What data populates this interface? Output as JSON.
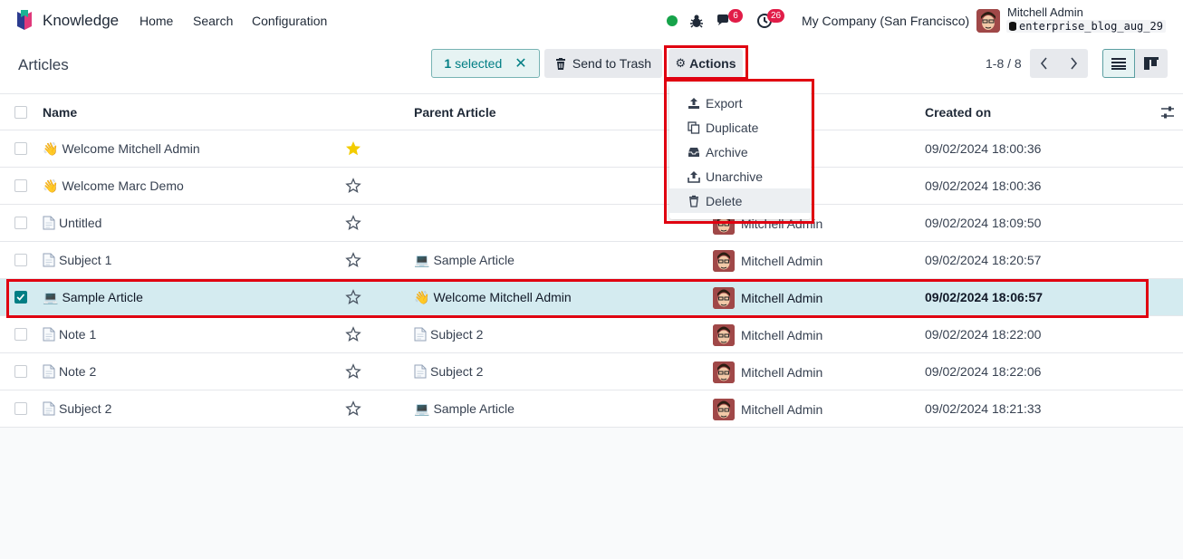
{
  "navbar": {
    "app_name": "Knowledge",
    "menu": [
      "Home",
      "Search",
      "Configuration"
    ],
    "messages_count": "6",
    "activities_count": "26",
    "company": "My Company (San Francisco)",
    "user_name": "Mitchell Admin",
    "database": "enterprise_blog_aug_29"
  },
  "control_panel": {
    "breadcrumb": "Articles",
    "selected_count": "1",
    "selected_label": "selected",
    "send_to_trash": "Send to Trash",
    "actions": "Actions",
    "pager": "1-8 / 8"
  },
  "actions_menu": [
    "Export",
    "Duplicate",
    "Archive",
    "Unarchive",
    "Delete"
  ],
  "table": {
    "columns": {
      "name": "Name",
      "parent": "Parent Article",
      "created_on": "Created on"
    },
    "rows": [
      {
        "icon": "👋",
        "name": "Welcome Mitchell Admin",
        "favorite": true,
        "parent_icon": "",
        "parent": "",
        "owner": "",
        "created": "09/02/2024 18:00:36",
        "selected": false
      },
      {
        "icon": "👋",
        "name": "Welcome Marc Demo",
        "favorite": false,
        "parent_icon": "",
        "parent": "",
        "owner": "",
        "created": "09/02/2024 18:00:36",
        "selected": false
      },
      {
        "icon": "doc",
        "name": "Untitled",
        "favorite": false,
        "parent_icon": "",
        "parent": "",
        "owner": "Mitchell Admin",
        "created": "09/02/2024 18:09:50",
        "selected": false
      },
      {
        "icon": "doc",
        "name": "Subject 1",
        "favorite": false,
        "parent_icon": "💻",
        "parent": "Sample Article",
        "owner": "Mitchell Admin",
        "created": "09/02/2024 18:20:57",
        "selected": false
      },
      {
        "icon": "💻",
        "name": "Sample Article",
        "favorite": false,
        "parent_icon": "👋",
        "parent": "Welcome Mitchell Admin",
        "owner": "Mitchell Admin",
        "created": "09/02/2024 18:06:57",
        "selected": true
      },
      {
        "icon": "doc",
        "name": "Note 1",
        "favorite": false,
        "parent_icon": "doc",
        "parent": "Subject 2",
        "owner": "Mitchell Admin",
        "created": "09/02/2024 18:22:00",
        "selected": false
      },
      {
        "icon": "doc",
        "name": "Note 2",
        "favorite": false,
        "parent_icon": "doc",
        "parent": "Subject 2",
        "owner": "Mitchell Admin",
        "created": "09/02/2024 18:22:06",
        "selected": false
      },
      {
        "icon": "doc",
        "name": "Subject 2",
        "favorite": false,
        "parent_icon": "💻",
        "parent": "Sample Article",
        "owner": "Mitchell Admin",
        "created": "09/02/2024 18:21:33",
        "selected": false
      }
    ]
  },
  "colors": {
    "accent": "#017e84",
    "highlight": "#e00010",
    "star": "#f3cc00",
    "selected_row": "#d4ebf0"
  }
}
